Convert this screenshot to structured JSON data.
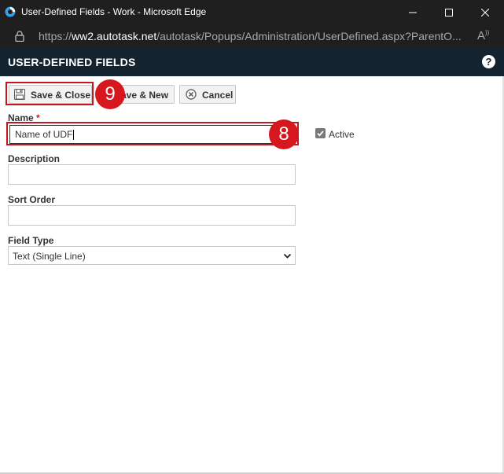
{
  "window": {
    "title": "User-Defined Fields - Work - Microsoft Edge"
  },
  "address": {
    "prefix": "https://",
    "host": "ww2.autotask.net",
    "path": "/autotask/Popups/Administration/UserDefined.aspx?ParentO..."
  },
  "header": {
    "title": "USER-DEFINED FIELDS",
    "help_icon": "question-circle-icon",
    "help_glyph": "?"
  },
  "toolbar": {
    "save_close_label": "Save & Close",
    "save_new_label": "ave & New",
    "cancel_label": "Cancel"
  },
  "callouts": {
    "step_save": "9",
    "step_name": "8"
  },
  "form": {
    "name_label": "Name",
    "name_required": "*",
    "name_value": "Name of UDF",
    "active_label": "Active",
    "active_checked": true,
    "description_label": "Description",
    "description_value": "",
    "sort_order_label": "Sort Order",
    "sort_order_value": "",
    "field_type_label": "Field Type",
    "field_type_value": "Text (Single Line)"
  },
  "colors": {
    "titlebar": "#1f1f1f",
    "header": "#13232f",
    "callout": "#d7171e"
  }
}
